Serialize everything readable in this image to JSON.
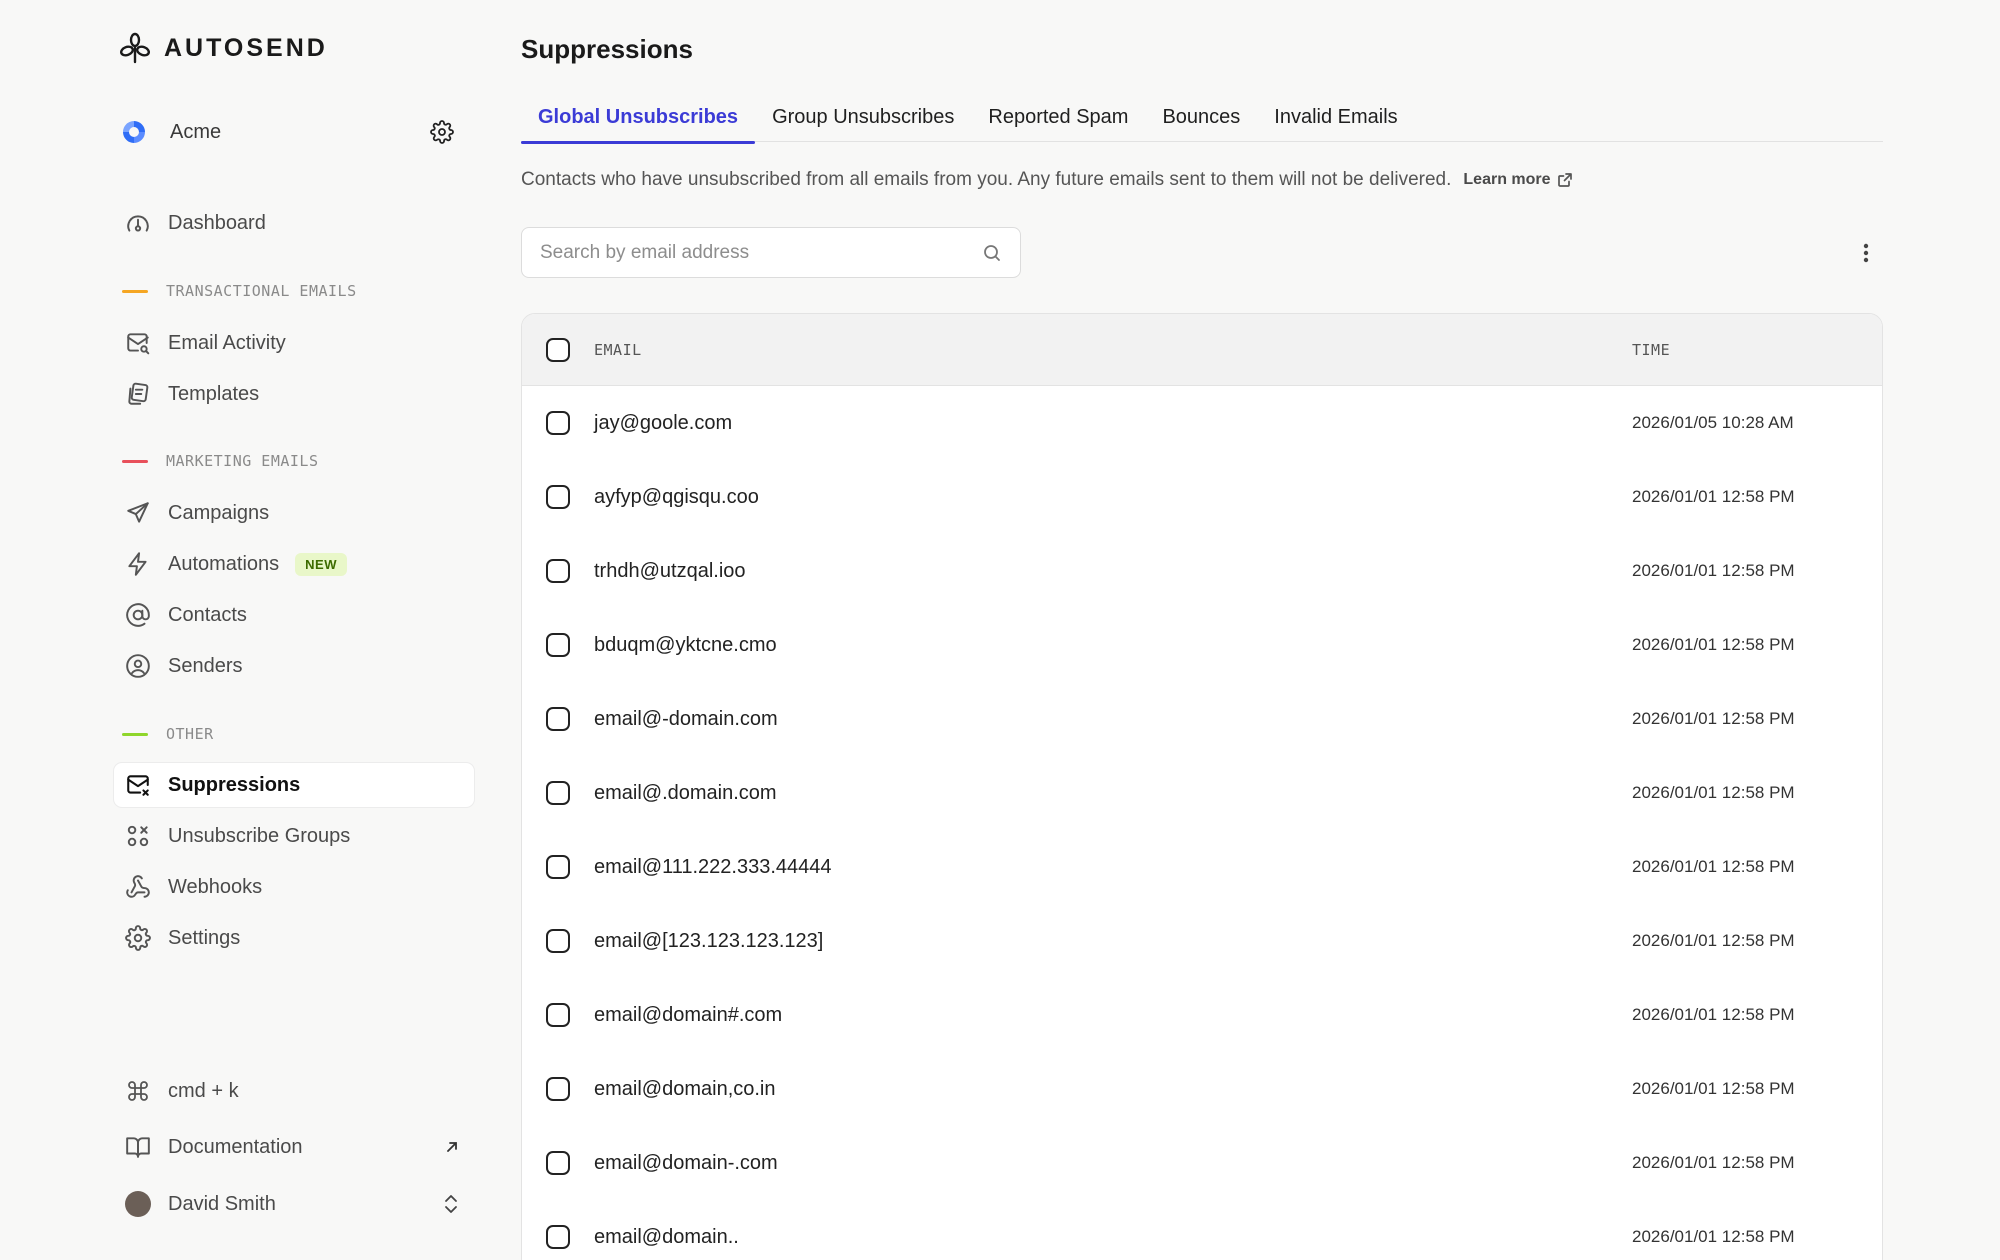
{
  "brand": {
    "name": "AUTOSEND"
  },
  "workspace": {
    "name": "Acme"
  },
  "sidebar": {
    "dashboard": "Dashboard",
    "sections": [
      {
        "label": "TRANSACTIONAL EMAILS",
        "color": "#f5a623"
      },
      {
        "label": "MARKETING EMAILS",
        "color": "#e8505b"
      },
      {
        "label": "OTHER",
        "color": "#8fd62b"
      }
    ],
    "transactional": [
      "Email Activity",
      "Templates"
    ],
    "marketing": [
      "Campaigns",
      "Automations",
      "Contacts",
      "Senders"
    ],
    "new_badge": "NEW",
    "other": [
      "Suppressions",
      "Unsubscribe Groups",
      "Webhooks",
      "Settings"
    ],
    "bottom": {
      "command": "cmd + k",
      "documentation": "Documentation",
      "user": "David Smith"
    }
  },
  "main": {
    "title": "Suppressions",
    "tabs": [
      "Global Unsubscribes",
      "Group Unsubscribes",
      "Reported Spam",
      "Bounces",
      "Invalid Emails"
    ],
    "active_tab": "Global Unsubscribes",
    "description": "Contacts who have unsubscribed from all emails from you. Any future emails sent to them will not be delivered.",
    "learn_more": "Learn more",
    "search_placeholder": "Search by email address",
    "table": {
      "columns": [
        "EMAIL",
        "TIME"
      ],
      "rows": [
        {
          "email": "jay@goole.com",
          "time": "2026/01/05 10:28 AM"
        },
        {
          "email": "ayfyp@qgisqu.coo",
          "time": "2026/01/01 12:58 PM"
        },
        {
          "email": "trhdh@utzqal.ioo",
          "time": "2026/01/01 12:58 PM"
        },
        {
          "email": "bduqm@yktcne.cmo",
          "time": "2026/01/01 12:58 PM"
        },
        {
          "email": "email@-domain.com",
          "time": "2026/01/01 12:58 PM"
        },
        {
          "email": "email@.domain.com",
          "time": "2026/01/01 12:58 PM"
        },
        {
          "email": "email@111.222.333.44444",
          "time": "2026/01/01 12:58 PM"
        },
        {
          "email": "email@[123.123.123.123]",
          "time": "2026/01/01 12:58 PM"
        },
        {
          "email": "email@domain#.com",
          "time": "2026/01/01 12:58 PM"
        },
        {
          "email": "email@domain,co.in",
          "time": "2026/01/01 12:58 PM"
        },
        {
          "email": "email@domain-.com",
          "time": "2026/01/01 12:58 PM"
        },
        {
          "email": "email@domain..",
          "time": "2026/01/01 12:58 PM"
        }
      ]
    }
  },
  "colors": {
    "accent": "#3b3bd6",
    "brand_blue": "#2f6df6"
  }
}
